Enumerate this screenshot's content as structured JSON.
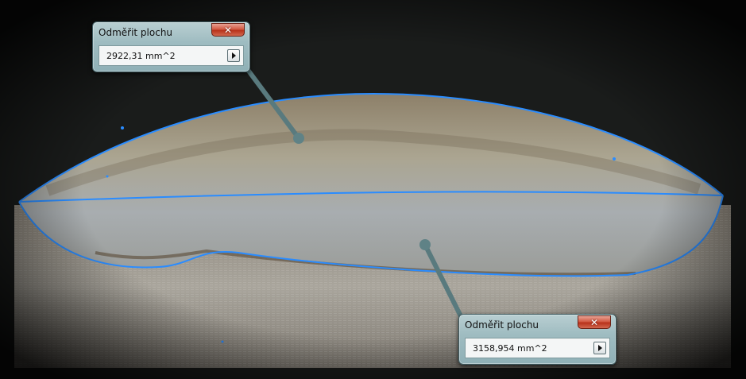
{
  "popups": [
    {
      "title": "Odměřit plochu",
      "close_label": "✕",
      "value": "2922,31 mm^2"
    },
    {
      "title": "Odměřit plochu",
      "close_label": "✕",
      "value": "3158,954 mm^2"
    }
  ],
  "colors": {
    "background": "#000000",
    "measure_line": "#2a8cff",
    "popup_frame": "#9fbcc1",
    "close_button": "#c9442b"
  },
  "icons": [
    "close-icon",
    "play-arrow-icon"
  ]
}
